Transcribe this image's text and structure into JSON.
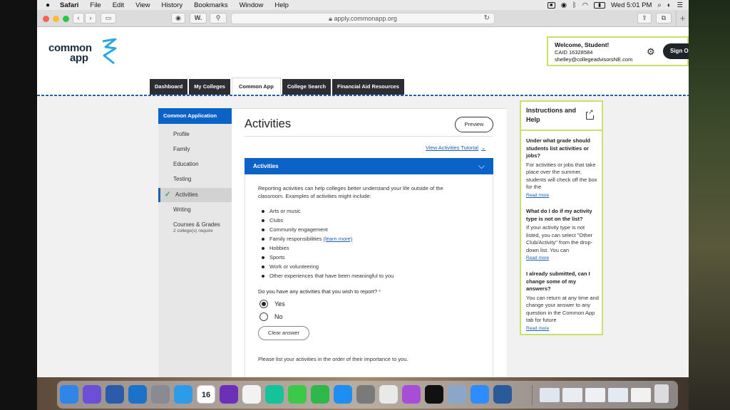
{
  "menubar": {
    "app": "Safari",
    "items": [
      "File",
      "Edit",
      "View",
      "History",
      "Bookmarks",
      "Window",
      "Help"
    ],
    "clock": "Wed 5:01 PM"
  },
  "browser": {
    "url": "apply.commonapp.org",
    "bookmark_w": "W.",
    "add_tab": "+"
  },
  "logo": {
    "line1": "common",
    "line2": "app"
  },
  "user": {
    "welcome": "Welcome, Student!",
    "caid": "CAID 16328584",
    "email": "shelley@collegeadvisorsNE.com",
    "sign_out": "Sign Out"
  },
  "nav_tabs": [
    "Dashboard",
    "My Colleges",
    "Common App",
    "College Search",
    "Financial Aid Resources"
  ],
  "sidebar": {
    "header": "Common Application",
    "items": [
      {
        "label": "Profile"
      },
      {
        "label": "Family"
      },
      {
        "label": "Education"
      },
      {
        "label": "Testing"
      },
      {
        "label": "Activities"
      },
      {
        "label": "Writing"
      },
      {
        "label": "Courses & Grades",
        "sub": "2 college(s) require"
      }
    ]
  },
  "main": {
    "title": "Activities",
    "preview": "Preview",
    "tutorial": "View Activities Tutorial",
    "section": "Activities",
    "intro": "Reporting activities can help colleges better understand your life outside of the classroom. Examples of activities might include:",
    "examples": [
      "Arts or music",
      "Clubs",
      "Community engagement",
      "Family responsibilities",
      "Hobbies",
      "Sports",
      "Work or volunteering",
      "Other experiences that have been meaningful to you"
    ],
    "learn_more": "(learn more)",
    "question": "Do you have any activities that you wish to report?",
    "required_mark": "*",
    "yes": "Yes",
    "no": "No",
    "clear": "Clear answer",
    "order_note": "Please list your activities in the order of their importance to you."
  },
  "help": {
    "title": "Instructions and Help",
    "faqs": [
      {
        "q": "Under what grade should students list activities or jobs?",
        "a": "For activities or jobs that take place over the summer, students will check off the box for the",
        "more": "Read more"
      },
      {
        "q": "What do I do if my activity type is not on the list?",
        "a": "If your activity type is not listed, you can select \"Other Club/Activity\" from the drop-down list. You can",
        "more": "Read more"
      },
      {
        "q": "I already submitted, can I change some of my answers?",
        "a": "You can return at any time and change your answer to any question in the Common App tab for future",
        "more": "Read more"
      }
    ]
  },
  "dock": {
    "calendar_day": "16",
    "items": [
      {
        "name": "finder",
        "color": "#2f86e6"
      },
      {
        "name": "siri",
        "color": "#6b4fd6"
      },
      {
        "name": "word",
        "color": "#2a5caa"
      },
      {
        "name": "outlook",
        "color": "#1a73c9"
      },
      {
        "name": "launchpad",
        "color": "#8a8a95"
      },
      {
        "name": "safari",
        "color": "#2c9be8"
      },
      {
        "name": "calendar",
        "color": "#ffffff"
      },
      {
        "name": "imovie-star",
        "color": "#6b2fb8"
      },
      {
        "name": "photos",
        "color": "#f2f2f2"
      },
      {
        "name": "grammarly",
        "color": "#15c39a"
      },
      {
        "name": "messages",
        "color": "#3bc94a"
      },
      {
        "name": "facetime",
        "color": "#2fb84a"
      },
      {
        "name": "app-store",
        "color": "#1f8ef1"
      },
      {
        "name": "system-preferences",
        "color": "#7a7a7a"
      },
      {
        "name": "chrome",
        "color": "#e9e9e9"
      },
      {
        "name": "podcasts",
        "color": "#a64fd6"
      },
      {
        "name": "apple-tv",
        "color": "#111111"
      },
      {
        "name": "preview",
        "color": "#8aa6c8"
      },
      {
        "name": "zoom",
        "color": "#2d8cff"
      },
      {
        "name": "quicktime",
        "color": "#2a5a9a"
      }
    ]
  }
}
